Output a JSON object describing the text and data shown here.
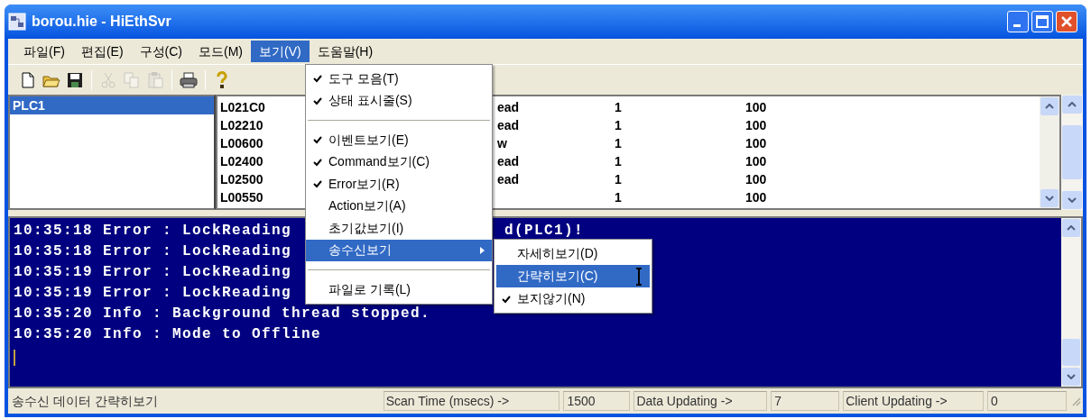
{
  "window": {
    "title": "borou.hie - HiEthSvr"
  },
  "menu_bar": [
    {
      "label": "파일(F)",
      "selected": false
    },
    {
      "label": "편집(E)",
      "selected": false
    },
    {
      "label": "구성(C)",
      "selected": false
    },
    {
      "label": "모드(M)",
      "selected": false
    },
    {
      "label": "보기(V)",
      "selected": true
    },
    {
      "label": "도움말(H)",
      "selected": false
    }
  ],
  "toolbar": [
    {
      "kind": "new",
      "disabled": false
    },
    {
      "kind": "open",
      "disabled": false
    },
    {
      "kind": "save",
      "disabled": false
    },
    {
      "kind": "separator"
    },
    {
      "kind": "cut",
      "disabled": true
    },
    {
      "kind": "copy",
      "disabled": true
    },
    {
      "kind": "paste",
      "disabled": true
    },
    {
      "kind": "separator"
    },
    {
      "kind": "print",
      "disabled": false
    },
    {
      "kind": "separator"
    },
    {
      "kind": "help",
      "disabled": false
    }
  ],
  "tree": [
    {
      "label": "PLC1",
      "selected": true
    }
  ],
  "list_rows": [
    {
      "column_1": "L021C0",
      "column_2": "ead",
      "column_3": "1",
      "column_4": "100"
    },
    {
      "column_1": "L02210",
      "column_2": "ead",
      "column_3": "1",
      "column_4": "100"
    },
    {
      "column_1": "L00600",
      "column_2": "w",
      "column_3": "1",
      "column_4": "100"
    },
    {
      "column_1": "L02400",
      "column_2": "ead",
      "column_3": "1",
      "column_4": "100"
    },
    {
      "column_1": "L02500",
      "column_2": "ead",
      "column_3": "1",
      "column_4": "100"
    },
    {
      "column_1": "L00550",
      "column_3": "1",
      "column_4": "100"
    }
  ],
  "log_lines": [
    {
      "text": "10:35:18 Error : LockReading",
      "tail": "d(PLC1)!"
    },
    {
      "text": "10:35:18 Error : LockReading"
    },
    {
      "text": "10:35:19 Error : LockReading"
    },
    {
      "text": "10:35:19 Error : LockReading"
    },
    {
      "text": "10:35:20 Info : Background thread stopped."
    },
    {
      "text": "10:35:20 Info : Mode to Offline"
    }
  ],
  "view_menu": [
    {
      "kind": "item",
      "label": "도구 모음(T)",
      "checked": true,
      "selected": false,
      "submenu": false
    },
    {
      "kind": "item",
      "label": "상태 표시줄(S)",
      "checked": true,
      "selected": false,
      "submenu": false
    },
    {
      "kind": "separator"
    },
    {
      "kind": "item",
      "label": "이벤트보기(E)",
      "checked": true,
      "selected": false,
      "submenu": false
    },
    {
      "kind": "item",
      "label": "Command보기(C)",
      "checked": true,
      "selected": false,
      "submenu": false
    },
    {
      "kind": "item",
      "label": "Error보기(R)",
      "checked": true,
      "selected": false,
      "submenu": false
    },
    {
      "kind": "item",
      "label": "Action보기(A)",
      "checked": false,
      "selected": false,
      "submenu": false
    },
    {
      "kind": "item",
      "label": "초기값보기(I)",
      "checked": false,
      "selected": false,
      "submenu": false
    },
    {
      "kind": "item",
      "label": "송수신보기",
      "checked": false,
      "selected": true,
      "submenu": true
    },
    {
      "kind": "separator"
    },
    {
      "kind": "item",
      "label": "파일로 기록(L)",
      "checked": false,
      "selected": false,
      "submenu": false
    }
  ],
  "submenu": [
    {
      "label": "자세히보기(D)",
      "checked": false,
      "selected": false
    },
    {
      "label": "간략히보기(C)",
      "checked": false,
      "selected": true
    },
    {
      "label": "보지않기(N)",
      "checked": true,
      "selected": false
    }
  ],
  "status_bar": {
    "message": "송수신 데이터 간략히보기",
    "panels": [
      {
        "label": "Scan Time (msecs) ->",
        "value": "1500"
      },
      {
        "label": "Data Updating ->",
        "value": "7"
      },
      {
        "label": "Client Updating ->",
        "value": "0"
      }
    ]
  }
}
